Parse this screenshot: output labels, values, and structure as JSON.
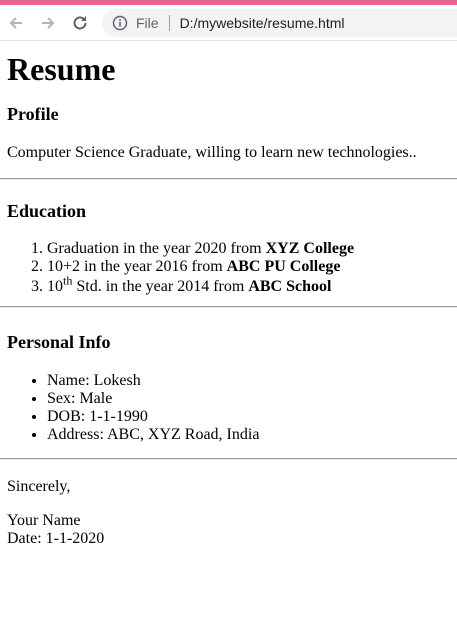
{
  "browser": {
    "accent_color": "#e8638f",
    "scheme": "File",
    "url": "D:/mywebsite/resume.html"
  },
  "page": {
    "title": "Resume",
    "profile": {
      "heading": "Profile",
      "text": "Computer Science Graduate, willing to learn new technologies.."
    },
    "education": {
      "heading": "Education",
      "items": [
        {
          "prefix": "Graduation in the year 2020 from ",
          "bold": "XYZ College"
        },
        {
          "prefix": "10+2 in the year 2016 from ",
          "bold": "ABC PU College"
        },
        {
          "prefix": "10",
          "sup": "th",
          "middle": " Std. in the year 2014 from ",
          "bold": "ABC School"
        }
      ]
    },
    "personal": {
      "heading": "Personal Info",
      "items": [
        "Name: Lokesh",
        "Sex: Male",
        "DOB: 1-1-1990",
        "Address: ABC, XYZ Road, India"
      ]
    },
    "closing": {
      "sincerely": "Sincerely,",
      "name": "Your Name",
      "date": "Date: 1-1-2020"
    }
  }
}
